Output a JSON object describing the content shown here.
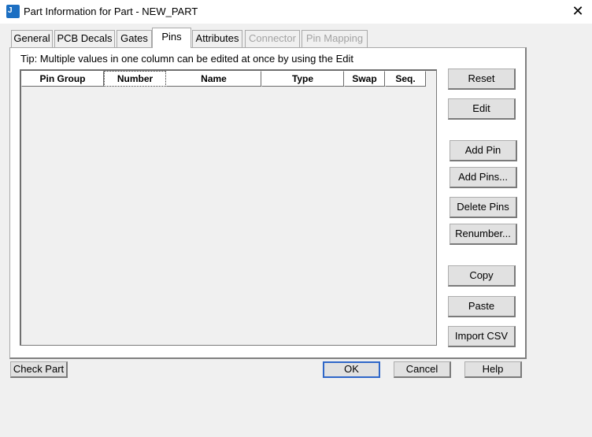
{
  "window": {
    "title": "Part Information for Part - NEW_PART",
    "close_symbol": "✕"
  },
  "tabs": [
    {
      "label": "General",
      "active": false,
      "disabled": false
    },
    {
      "label": "PCB Decals",
      "active": false,
      "disabled": false
    },
    {
      "label": "Gates",
      "active": false,
      "disabled": false
    },
    {
      "label": "Pins",
      "active": true,
      "disabled": false
    },
    {
      "label": "Attributes",
      "active": false,
      "disabled": false
    },
    {
      "label": "Connector",
      "active": false,
      "disabled": true
    },
    {
      "label": "Pin Mapping",
      "active": false,
      "disabled": true
    }
  ],
  "tip": "Tip: Multiple values in one column can be edited at once by using the Edit",
  "grid": {
    "columns": [
      "Pin Group",
      "Number",
      "Name",
      "Type",
      "Swap",
      "Seq."
    ],
    "rows": []
  },
  "side_buttons": {
    "reset": "Reset",
    "edit": "Edit",
    "add_pin": "Add Pin",
    "add_pins": "Add Pins...",
    "delete_pins": "Delete Pins",
    "renumber": "Renumber...",
    "copy": "Copy",
    "paste": "Paste",
    "import_csv": "Import CSV"
  },
  "bottom_buttons": {
    "check_part": "Check Part",
    "ok": "OK",
    "cancel": "Cancel",
    "help": "Help"
  },
  "colors": {
    "accent": "#2e66c8",
    "app_icon": "#1c6fc2",
    "disabled_text": "#a3a3a3"
  },
  "icons": {
    "app": "app-logo-icon",
    "close": "close-icon"
  }
}
